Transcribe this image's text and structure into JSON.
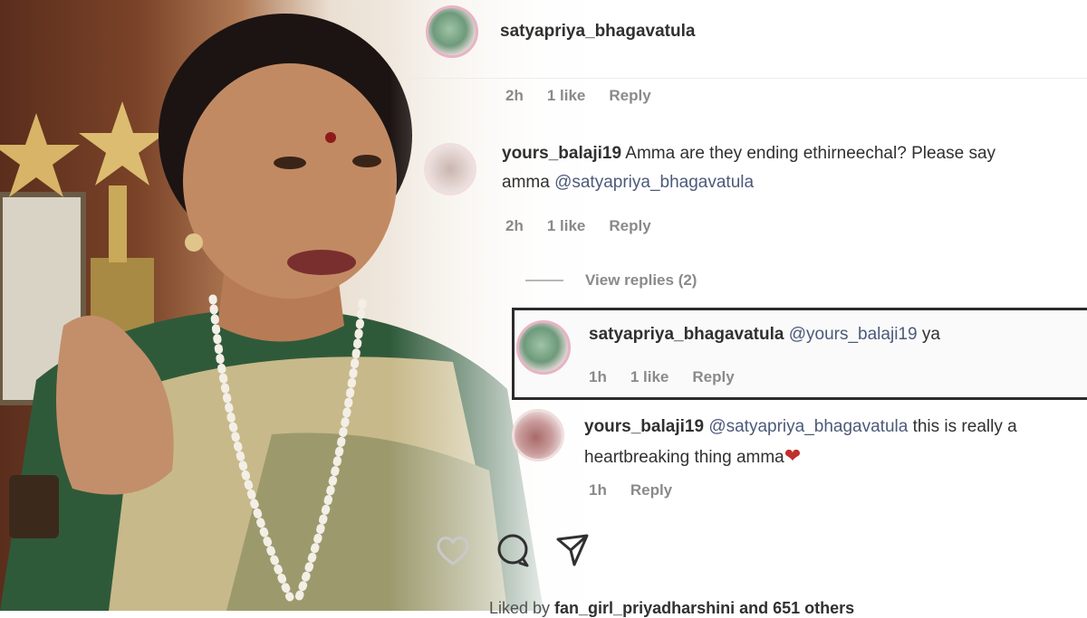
{
  "header": {
    "username": "satyapriya_bhagavatula"
  },
  "first_meta": {
    "time": "2h",
    "likes": "1 like",
    "reply": "Reply"
  },
  "comments": [
    {
      "username": "yours_balaji19",
      "text_line1": "Amma are they ending ethirneechal? Please say",
      "text_line2_prefix": "amma ",
      "mention": "@satyapriya_bhagavatula",
      "time": "2h",
      "likes": "1 like",
      "reply": "Reply"
    }
  ],
  "view_replies": "View replies (2)",
  "replies": [
    {
      "username": "satyapriya_bhagavatula",
      "mention": "@yours_balaji19",
      "text": " ya",
      "time": "1h",
      "likes": "1 like",
      "reply": "Reply"
    },
    {
      "username": "yours_balaji19",
      "mention": "@satyapriya_bhagavatula",
      "text_line1": " this is really a",
      "text_line2": "heartbreaking thing amma",
      "emoji": "❤",
      "time": "1h",
      "reply": "Reply"
    }
  ],
  "actions": {
    "icons": [
      "heart-icon",
      "comment-icon",
      "share-icon"
    ]
  },
  "likes_summary": {
    "prefix": "Liked by ",
    "user": "fan_girl_priyadharshini",
    "suffix": " and 651 others"
  },
  "colors": {
    "text": "#303030",
    "muted": "#8a8a8a",
    "mention": "#4c5a7a",
    "heart": "#c0302c"
  }
}
